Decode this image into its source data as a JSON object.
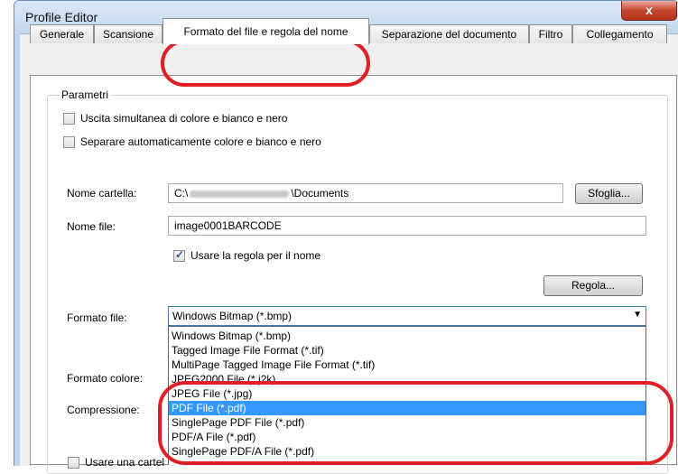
{
  "window": {
    "title": "Profile Editor",
    "close_symbol": "x"
  },
  "tabs": [
    {
      "label": "Generale"
    },
    {
      "label": "Scansione"
    },
    {
      "label": "Formato del file e regola del nome"
    },
    {
      "label": "Separazione del documento"
    },
    {
      "label": "Filtro"
    },
    {
      "label": "Collegamento"
    }
  ],
  "group": {
    "label": "Parametri"
  },
  "options": {
    "simultaneous_output": "Uscita simultanea di colore e bianco e nero",
    "auto_separate": "Separare automaticamente colore e bianco e nero"
  },
  "folder": {
    "label": "Nome cartella:",
    "value_prefix": "C:\\",
    "value_suffix": "\\Documents",
    "browse_label": "Sfoglia..."
  },
  "file": {
    "label": "Nome file:",
    "value": "image0001BARCODE",
    "use_rule_label": "Usare la regola per il nome",
    "rule_button": "Regola..."
  },
  "format": {
    "label": "Formato file:",
    "selected": "Windows Bitmap (*.bmp)",
    "options": [
      "Windows Bitmap (*.bmp)",
      "Tagged Image File Format (*.tif)",
      "MultiPage Tagged Image File Format (*.tif)",
      "JPEG2000 File (*.j2k)",
      "JPEG File (*.jpg)",
      "PDF File (*.pdf)",
      "SinglePage PDF File (*.pdf)",
      "PDF/A File (*.pdf)",
      "SinglePage PDF/A File (*.pdf)"
    ],
    "highlighted_index": 5
  },
  "color_format": {
    "label": "Formato colore:"
  },
  "compression": {
    "label": "Compressione:"
  },
  "bottom_checkbox": {
    "label": "Usare una cartel"
  },
  "colors": {
    "highlight": "#3399ff",
    "annotation": "#e01e26"
  }
}
